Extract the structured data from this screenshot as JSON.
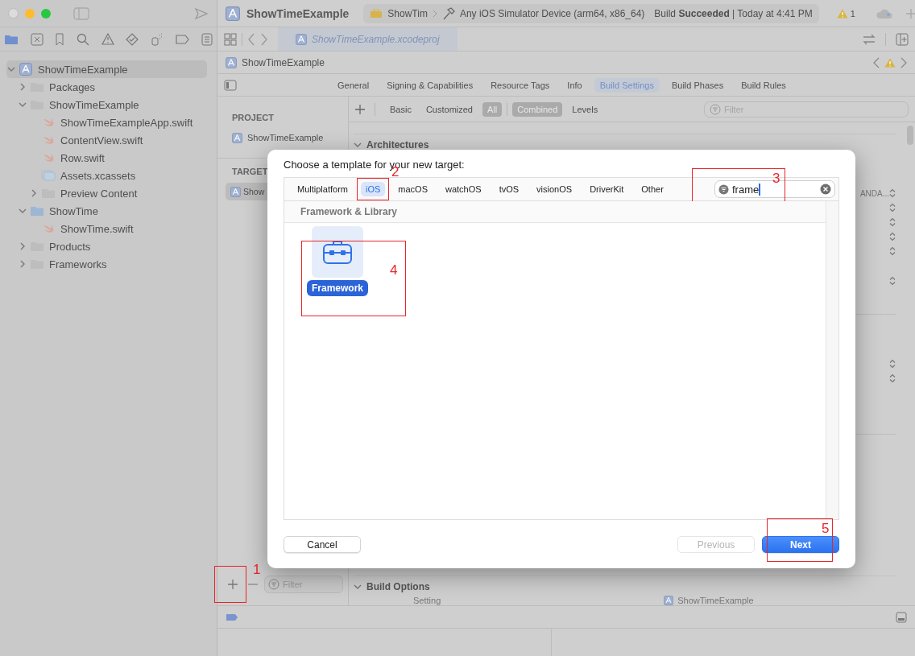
{
  "window": {
    "title": "ShowTimeExample",
    "scheme": "ShowTim",
    "destination": "Any iOS Simulator Device (arm64, x86_64)",
    "status": "Build **Succeeded** | Today at 4:41 PM",
    "warning_count": "1"
  },
  "navigator": {
    "tree": [
      {
        "label": "ShowTimeExample",
        "kind": "project",
        "selected": true,
        "expanded": true,
        "children": [
          {
            "label": "Packages",
            "kind": "folder",
            "selected": false,
            "expanded": false
          },
          {
            "label": "ShowTimeExample",
            "kind": "folder",
            "selected": false,
            "expanded": true,
            "children": [
              {
                "label": "ShowTimeExampleApp.swift",
                "kind": "swift",
                "selected": false
              },
              {
                "label": "ContentView.swift",
                "kind": "swift",
                "selected": false
              },
              {
                "label": "Row.swift",
                "kind": "swift",
                "selected": false
              },
              {
                "label": "Assets.xcassets",
                "kind": "assets",
                "selected": false
              },
              {
                "label": "Preview Content",
                "kind": "folder",
                "selected": false,
                "expanded": false
              }
            ]
          },
          {
            "label": "ShowTime",
            "kind": "target",
            "selected": false,
            "expanded": true,
            "children": [
              {
                "label": "ShowTime.swift",
                "kind": "swift",
                "selected": false
              }
            ]
          },
          {
            "label": "Products",
            "kind": "folder",
            "selected": false,
            "expanded": false
          },
          {
            "label": "Frameworks",
            "kind": "folder",
            "selected": false,
            "expanded": false
          }
        ]
      }
    ]
  },
  "editor_tab": "ShowTimeExample.xcodeproj",
  "jump_bar": "ShowTimeExample",
  "editor_tabs": [
    {
      "label": "General",
      "selected": false
    },
    {
      "label": "Signing & Capabilities",
      "selected": false
    },
    {
      "label": "Resource Tags",
      "selected": false
    },
    {
      "label": "Info",
      "selected": false
    },
    {
      "label": "Build Settings",
      "selected": true
    },
    {
      "label": "Build Phases",
      "selected": false
    },
    {
      "label": "Build Rules",
      "selected": false
    }
  ],
  "project_list": {
    "project_header": "PROJECT",
    "projects": [
      {
        "label": "ShowTimeExample",
        "selected": false
      }
    ],
    "targets_header": "TARGET",
    "targets": [
      {
        "label": "Show",
        "selected": true
      }
    ],
    "filter_placeholder": "Filter",
    "add_annotation": "1"
  },
  "settings": {
    "filters": [
      {
        "label": "Basic",
        "selected": false
      },
      {
        "label": "Customized",
        "selected": false
      },
      {
        "label": "All",
        "selected": true
      }
    ],
    "views": [
      {
        "label": "Combined",
        "selected": true
      },
      {
        "label": "Levels",
        "selected": false
      }
    ],
    "filter_placeholder": "Filter",
    "first_section": "Architectures",
    "first_value": "ANDA...",
    "second_section": "Build Options",
    "column_1": "Setting",
    "column_2": "ShowTimeExample"
  },
  "dialog": {
    "title": "Choose a template for your new target:",
    "platforms": [
      {
        "label": "Multiplatform",
        "selected": false
      },
      {
        "label": "iOS",
        "selected": true,
        "annotation": "2"
      },
      {
        "label": "macOS",
        "selected": false
      },
      {
        "label": "watchOS",
        "selected": false
      },
      {
        "label": "tvOS",
        "selected": false
      },
      {
        "label": "visionOS",
        "selected": false
      },
      {
        "label": "DriverKit",
        "selected": false
      },
      {
        "label": "Other",
        "selected": false
      }
    ],
    "search": {
      "value": "frame",
      "annotation": "3"
    },
    "section": "Framework & Library",
    "templates": [
      {
        "label": "Framework",
        "selected": true,
        "annotation": "4"
      }
    ],
    "buttons": [
      {
        "label": "Cancel",
        "disabled": false,
        "default": false
      },
      {
        "label": "Previous",
        "disabled": true,
        "default": false
      },
      {
        "label": "Next",
        "disabled": false,
        "default": true,
        "annotation": "5"
      }
    ]
  }
}
